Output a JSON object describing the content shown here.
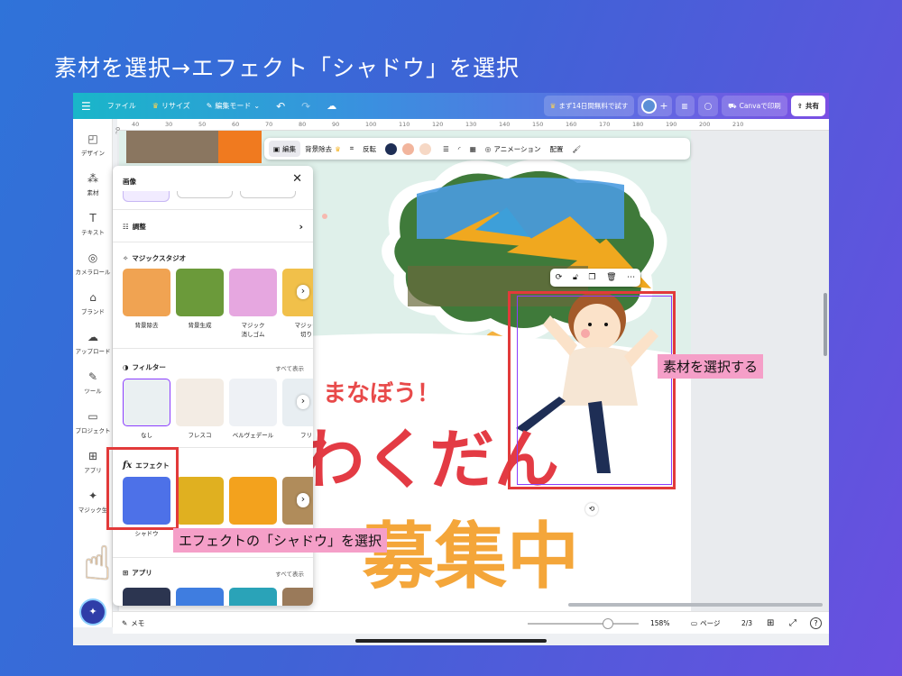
{
  "title": "素材を選択→エフェクト「シャドウ」を選択",
  "topbar": {
    "menu_icon": "menu-icon",
    "file": "ファイル",
    "resize": "リサイズ",
    "edit_mode": "編集モード",
    "trial": "まず14日間無料で試す",
    "print": "Canvaで印刷",
    "share": "共有"
  },
  "ruler": [
    "40",
    "30",
    "50",
    "60",
    "70",
    "80",
    "90",
    "100",
    "110",
    "120",
    "130",
    "140",
    "150",
    "160",
    "170",
    "180",
    "190",
    "200",
    "210"
  ],
  "ruler_side": "20",
  "leftnav": [
    {
      "label": "デザイン",
      "icon": "◰"
    },
    {
      "label": "素材",
      "icon": "⁂"
    },
    {
      "label": "テキスト",
      "icon": "T"
    },
    {
      "label": "カメラロール",
      "icon": "◎"
    },
    {
      "label": "ブランド",
      "icon": "⌂"
    },
    {
      "label": "アップロード",
      "icon": "☁"
    },
    {
      "label": "ツール",
      "icon": "✎"
    },
    {
      "label": "プロジェクト",
      "icon": "▭"
    },
    {
      "label": "アプリ",
      "icon": "⊞"
    },
    {
      "label": "マジック生",
      "icon": "✦"
    }
  ],
  "floatbar": {
    "edit": "編集",
    "bg_remove": "背景除去",
    "flip": "反転",
    "colors": [
      "#1e2e55",
      "#f2b59d",
      "#f6d8c5"
    ],
    "animation": "アニメーション",
    "position": "配置"
  },
  "panel": {
    "header": "画像",
    "adjust": "調整",
    "magic_studio": "マジックスタジオ",
    "magic_items": [
      "背景除去",
      "背景生成",
      "マジック\n消しゴム",
      "マジック\n切り"
    ],
    "filters": "フィルター",
    "show_all": "すべて表示",
    "filter_items": [
      "なし",
      "フレスコ",
      "ベルヴェデール",
      "フリ"
    ],
    "effects": "エフェクト",
    "effect_items": [
      "シャドウ"
    ],
    "apps": "アプリ",
    "apps_show_all": "すべて表示"
  },
  "canvas": {
    "tagline": "！まなぼう！",
    "headline": "わくだん",
    "subline": "募集中"
  },
  "bottombar": {
    "memo": "メモ",
    "zoom": "158%",
    "page": "ページ",
    "page_count": "2/3",
    "zoom_fraction": 0.72
  },
  "callouts": {
    "select_asset": "素材を選択する",
    "select_shadow": "エフェクトの「シャドウ」を選択"
  }
}
